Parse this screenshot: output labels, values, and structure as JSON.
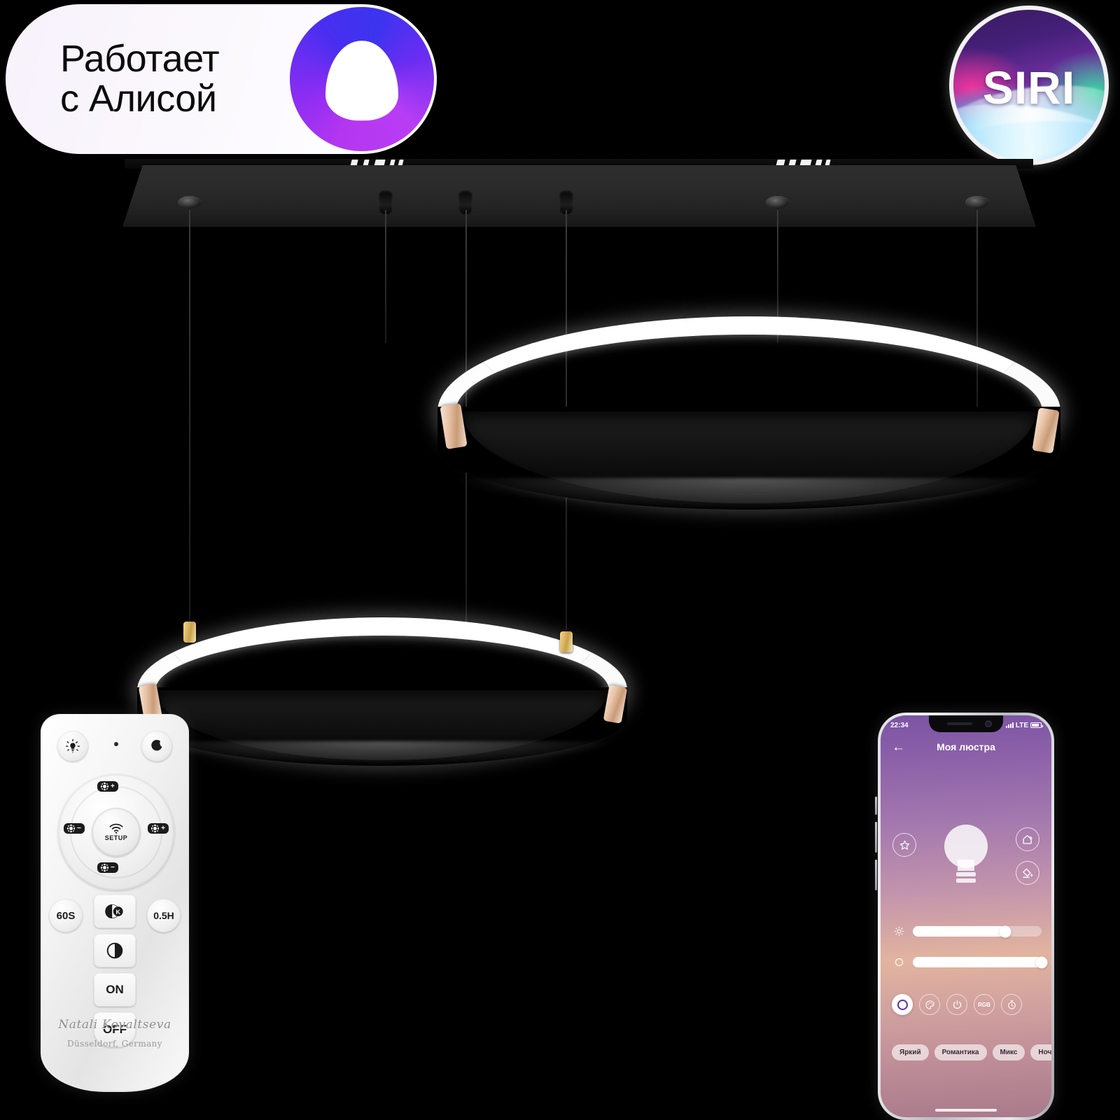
{
  "badges": {
    "alice": {
      "text": "Работает\nс Алисой",
      "logo_icon": "alice-assistant-logo",
      "colors": {
        "pill_bg": "#f9f5fd",
        "logo_from": "#b536f0",
        "logo_to": "#3b34ef"
      }
    },
    "siri": {
      "label": "SIRI",
      "icon": "siri-orb-icon",
      "colors": {
        "ring": "#f2f2f4",
        "top": "#3a1a5e",
        "wave": "#5fd6f7",
        "accent": "#f0349b"
      }
    }
  },
  "product": {
    "type": "pendant-chandelier",
    "canopy": {
      "name": "ceiling-mount-plate",
      "color": "#262626"
    },
    "rings": [
      {
        "name": "upper-led-ring",
        "lit_color": "#ffffff",
        "body_color": "#101010",
        "clip_color": "#e8c3a6"
      },
      {
        "name": "lower-led-ring",
        "lit_color": "#ffffff",
        "body_color": "#101010",
        "clip_color": "#e8c3a6"
      }
    ],
    "cable_color": "#2a2a2a"
  },
  "remote": {
    "name": "ir-rf-remote-control",
    "top_buttons": [
      {
        "id": "day-mode",
        "icon": "sun-bulb-icon"
      },
      {
        "id": "ir-indicator",
        "icon": "led-dot-icon"
      },
      {
        "id": "night-mode",
        "icon": "moon-star-icon"
      }
    ],
    "dpad": {
      "center_label": "SETUP",
      "center_icon": "wifi-icon",
      "up": {
        "icon": "brightness-icon",
        "sign": "+"
      },
      "down": {
        "icon": "brightness-icon",
        "sign": "−"
      },
      "left": {
        "icon": "color-temp-icon",
        "sign": "−"
      },
      "right": {
        "icon": "color-temp-icon",
        "sign": "+"
      }
    },
    "mid_buttons": [
      {
        "id": "timer-60s",
        "label": "60S"
      },
      {
        "id": "color-temp-k",
        "label": "K",
        "icon": "half-moon-k-icon"
      },
      {
        "id": "timer-half-hour",
        "label": "0.5H"
      }
    ],
    "lower_buttons": [
      {
        "id": "dimmer",
        "label": "",
        "icon": "contrast-circle-icon"
      },
      {
        "id": "power-on",
        "label": "ON"
      },
      {
        "id": "power-off",
        "label": "OFF"
      }
    ],
    "brand": "Natali Kovaltseva",
    "origin": "Düsseldorf, Germany"
  },
  "phone": {
    "status_bar": {
      "time": "22:34",
      "network": "LTE",
      "signal_icon": "signal-bars-icon",
      "battery_icon": "battery-icon"
    },
    "app_bar": {
      "back_icon": "back-arrow-icon",
      "title": "Моя люстра"
    },
    "hero": {
      "icon": "light-bulb-icon"
    },
    "side_icons": [
      {
        "id": "favorites",
        "icon": "star-icon",
        "side": "left"
      },
      {
        "id": "home-group",
        "icon": "home-wifi-icon",
        "side": "right"
      },
      {
        "id": "color-fill",
        "icon": "paint-bucket-icon",
        "side": "right"
      }
    ],
    "sliders": [
      {
        "id": "brightness",
        "icon": "sun-icon",
        "value": 72
      },
      {
        "id": "color-temperature",
        "icon": "circle-icon",
        "value": 100
      }
    ],
    "toolbar": [
      {
        "id": "white-mode",
        "icon": "circle-ring-icon",
        "label": "",
        "active": true
      },
      {
        "id": "palette",
        "icon": "palette-icon",
        "label": "",
        "active": false
      },
      {
        "id": "power",
        "icon": "power-icon",
        "label": "",
        "active": false
      },
      {
        "id": "rgb-mode",
        "icon": "rgb-text-icon",
        "label": "RGB",
        "active": false
      },
      {
        "id": "timer",
        "icon": "timer-icon",
        "label": "",
        "active": false
      }
    ],
    "presets": [
      {
        "id": "bright",
        "label": "Яркий"
      },
      {
        "id": "romantic",
        "label": "Романтика"
      },
      {
        "id": "mix",
        "label": "Микс"
      },
      {
        "id": "night-light",
        "label": "Ночник"
      }
    ],
    "colors": {
      "gradient_top": "#7b54a3",
      "gradient_mid": "#e2b49f",
      "gradient_bottom": "#a97a8b",
      "accent": "#5b2ea8"
    }
  }
}
